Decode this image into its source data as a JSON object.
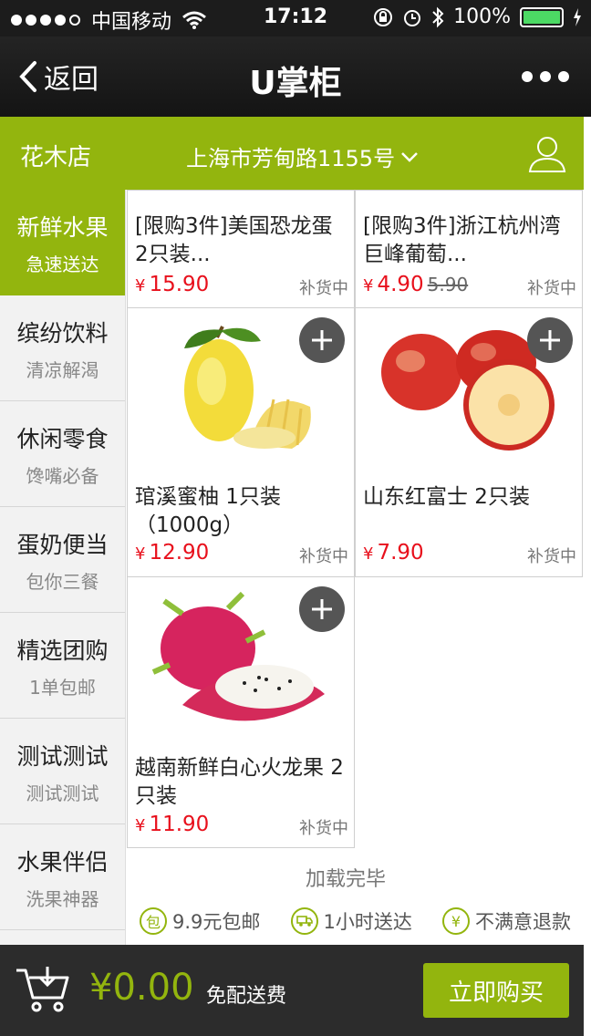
{
  "status_bar": {
    "carrier": "中国移动",
    "time": "17:12",
    "battery": "100%",
    "battery_level": 1.0
  },
  "nav": {
    "back_label": "返回",
    "title": "U掌柜"
  },
  "store_bar": {
    "store_name": "花木店",
    "address": "上海市芳甸路1155号"
  },
  "categories": [
    {
      "name": "新鲜水果",
      "sub": "急速送达"
    },
    {
      "name": "缤纷饮料",
      "sub": "清凉解渴"
    },
    {
      "name": "休闲零食",
      "sub": "馋嘴必备"
    },
    {
      "name": "蛋奶便当",
      "sub": "包你三餐"
    },
    {
      "name": "精选团购",
      "sub": "1单包邮"
    },
    {
      "name": "测试测试",
      "sub": "测试测试"
    },
    {
      "name": "水果伴侣",
      "sub": "洗果神器"
    }
  ],
  "products": [
    {
      "name": "[限购3件]美国恐龙蛋 2只装...",
      "currency": "¥",
      "price": "15.90",
      "stock": "补货中"
    },
    {
      "name": "[限购3件]浙江杭州湾巨峰葡萄...",
      "currency": "¥",
      "price": "4.90",
      "old_price": "5.90",
      "stock": "补货中"
    },
    {
      "name": "琯溪蜜柚 1只装（1000g）",
      "currency": "¥",
      "price": "12.90",
      "stock": "补货中",
      "image": "pomelo"
    },
    {
      "name": "山东红富士 2只装",
      "currency": "¥",
      "price": "7.90",
      "stock": "补货中",
      "image": "apple"
    },
    {
      "name": "越南新鲜白心火龙果 2只装",
      "currency": "¥",
      "price": "11.90",
      "stock": "补货中",
      "image": "dragonfruit"
    }
  ],
  "list_footer": {
    "loaded_text": "加载完毕"
  },
  "guarantees": [
    {
      "icon": "包",
      "text": "9.9元包邮"
    },
    {
      "icon": "truck-icon",
      "text": "1小时送达"
    },
    {
      "icon": "¥",
      "text": "不满意退款"
    }
  ],
  "cart_bar": {
    "total": "¥0.00",
    "free_shipping": "免配送费",
    "buy_label": "立即购买"
  },
  "colors": {
    "accent": "#93b50e",
    "price_red": "#e8101c",
    "dark_bar": "#2c2c2c"
  }
}
